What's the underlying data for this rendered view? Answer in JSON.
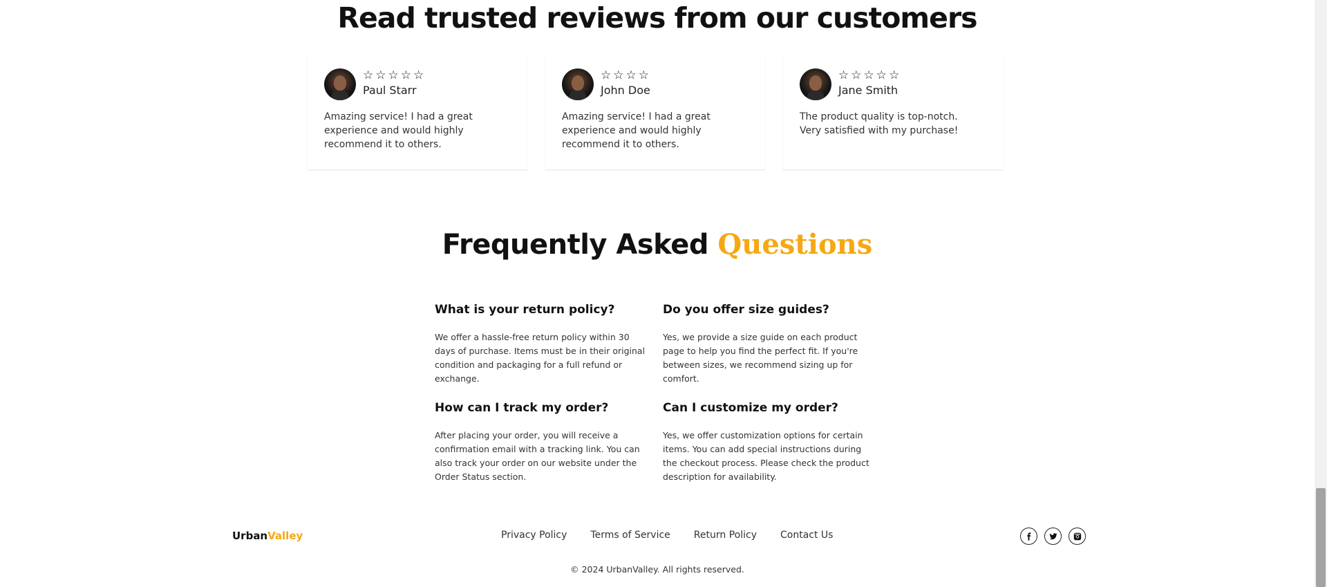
{
  "reviews": {
    "title": "Read trusted reviews from our customers",
    "items": [
      {
        "name": "Paul Starr",
        "text": "Amazing service! I had a great experience and would highly recommend it to others.",
        "rating_shown": 5
      },
      {
        "name": "John Doe",
        "text": "Amazing service! I had a great experience and would highly recommend it to others.",
        "rating_shown": 4
      },
      {
        "name": "Jane Smith",
        "text": "The product quality is top-notch. Very satisfied with my purchase!",
        "rating_shown": 5
      }
    ]
  },
  "faq": {
    "title_main": "Frequently Asked",
    "title_accent": "Questions",
    "items": [
      {
        "question": "What is your return policy?",
        "answer": "We offer a hassle-free return policy within 30 days of purchase. Items must be in their original condition and packaging for a full refund or exchange."
      },
      {
        "question": "Do you offer size guides?",
        "answer": "Yes, we provide a size guide on each product page to help you find the perfect fit. If you're between sizes, we recommend sizing up for comfort."
      },
      {
        "question": "How can I track my order?",
        "answer": "After placing your order, you will receive a confirmation email with a tracking link. You can also track your order on our website under the Order Status section."
      },
      {
        "question": "Can I customize my order?",
        "answer": "Yes, we offer customization options for certain items. You can add special instructions during the checkout process. Please check the product description for availability."
      }
    ]
  },
  "footer": {
    "brand_main": "Urban",
    "brand_accent": "Valley",
    "links": [
      "Privacy Policy",
      "Terms of Service",
      "Return Policy",
      "Contact Us"
    ],
    "socials": [
      {
        "icon": "facebook-icon",
        "glyph": "f"
      },
      {
        "icon": "twitter-icon",
        "glyph": "🐦"
      },
      {
        "icon": "instagram-icon",
        "glyph": "◙"
      }
    ],
    "copyright": "© 2024 UrbanValley. All rights reserved."
  },
  "colors": {
    "accent": "#f5a814",
    "text": "#111111"
  }
}
